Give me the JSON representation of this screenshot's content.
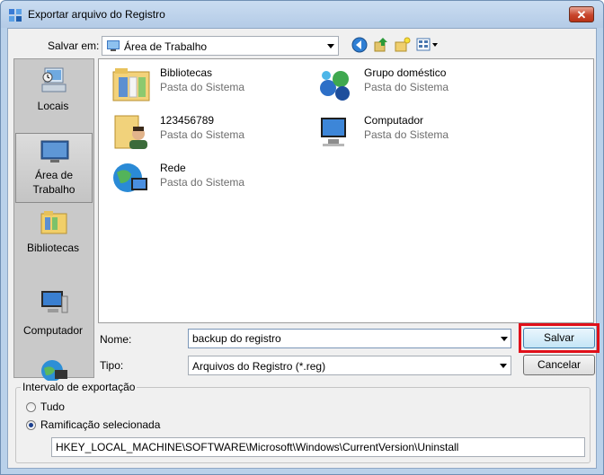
{
  "window": {
    "title": "Exportar arquivo do Registro",
    "close_label": "✕"
  },
  "toolbar": {
    "save_in_label": "Salvar em:",
    "save_in_value": "Área de Trabalho"
  },
  "places": [
    {
      "label": "Locais"
    },
    {
      "label": "Área de Trabalho"
    },
    {
      "label": "Bibliotecas"
    },
    {
      "label": "Computador"
    },
    {
      "label": ""
    }
  ],
  "files": [
    {
      "name": "Bibliotecas",
      "type": "Pasta do Sistema"
    },
    {
      "name": "Grupo doméstico",
      "type": "Pasta do Sistema"
    },
    {
      "name": "123456789",
      "type": "Pasta do Sistema"
    },
    {
      "name": "Computador",
      "type": "Pasta do Sistema"
    },
    {
      "name": "Rede",
      "type": "Pasta do Sistema"
    }
  ],
  "form": {
    "name_label": "Nome:",
    "name_value": "backup do registro",
    "type_label": "Tipo:",
    "type_value": "Arquivos do Registro (*.reg)",
    "save_button": "Salvar",
    "cancel_button": "Cancelar"
  },
  "export_range": {
    "legend": "Intervalo de exportação",
    "option_all": "Tudo",
    "option_selected": "Ramificação selecionada",
    "selected_value": "selected",
    "key_path": "HKEY_LOCAL_MACHINE\\SOFTWARE\\Microsoft\\Windows\\CurrentVersion\\Uninstall"
  },
  "colors": {
    "highlight": "#e0101a",
    "accent": "#3c7fb1"
  }
}
